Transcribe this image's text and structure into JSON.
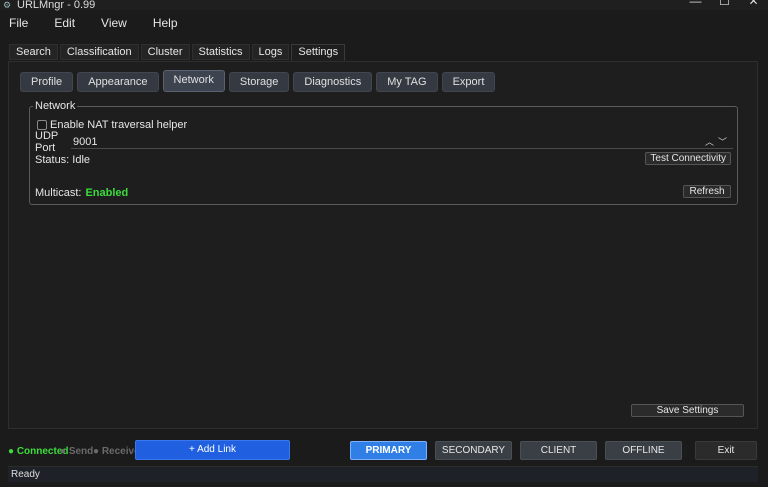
{
  "window": {
    "title": "URLMngr - 0.99",
    "minimize": "—",
    "maximize": "☐",
    "close": "✕"
  },
  "menu": [
    "File",
    "Edit",
    "View",
    "Help"
  ],
  "main_tabs": [
    "Search",
    "Classification",
    "Cluster",
    "Statistics",
    "Logs",
    "Settings"
  ],
  "main_tab_active": "Settings",
  "sub_tabs": [
    "Profile",
    "Appearance",
    "Network",
    "Storage",
    "Diagnostics",
    "My TAG",
    "Export"
  ],
  "sub_tab_active": "Network",
  "network": {
    "group_title": "Network",
    "nat_label": "Enable NAT traversal helper",
    "nat_checked": false,
    "udp_label": "UDP Port",
    "udp_value": "9001",
    "status_label": "Status: Idle",
    "test_button": "Test Connectivity",
    "multicast_label": "Multicast:",
    "multicast_value": "Enabled",
    "refresh_button": "Refresh"
  },
  "save_button": "Save Settings",
  "indicators": {
    "connected": "● Connected",
    "send": "● Send",
    "receive": "● Receive"
  },
  "add_link_button": "+ Add Link",
  "modes": [
    "PRIMARY",
    "SECONDARY",
    "CLIENT",
    "OFFLINE"
  ],
  "mode_active": "PRIMARY",
  "exit_button": "Exit",
  "status_text": "Ready",
  "colors": {
    "accent": "#1f5fe0",
    "active_mode": "#2f7fe6",
    "enabled_green": "#3ddc3d"
  }
}
